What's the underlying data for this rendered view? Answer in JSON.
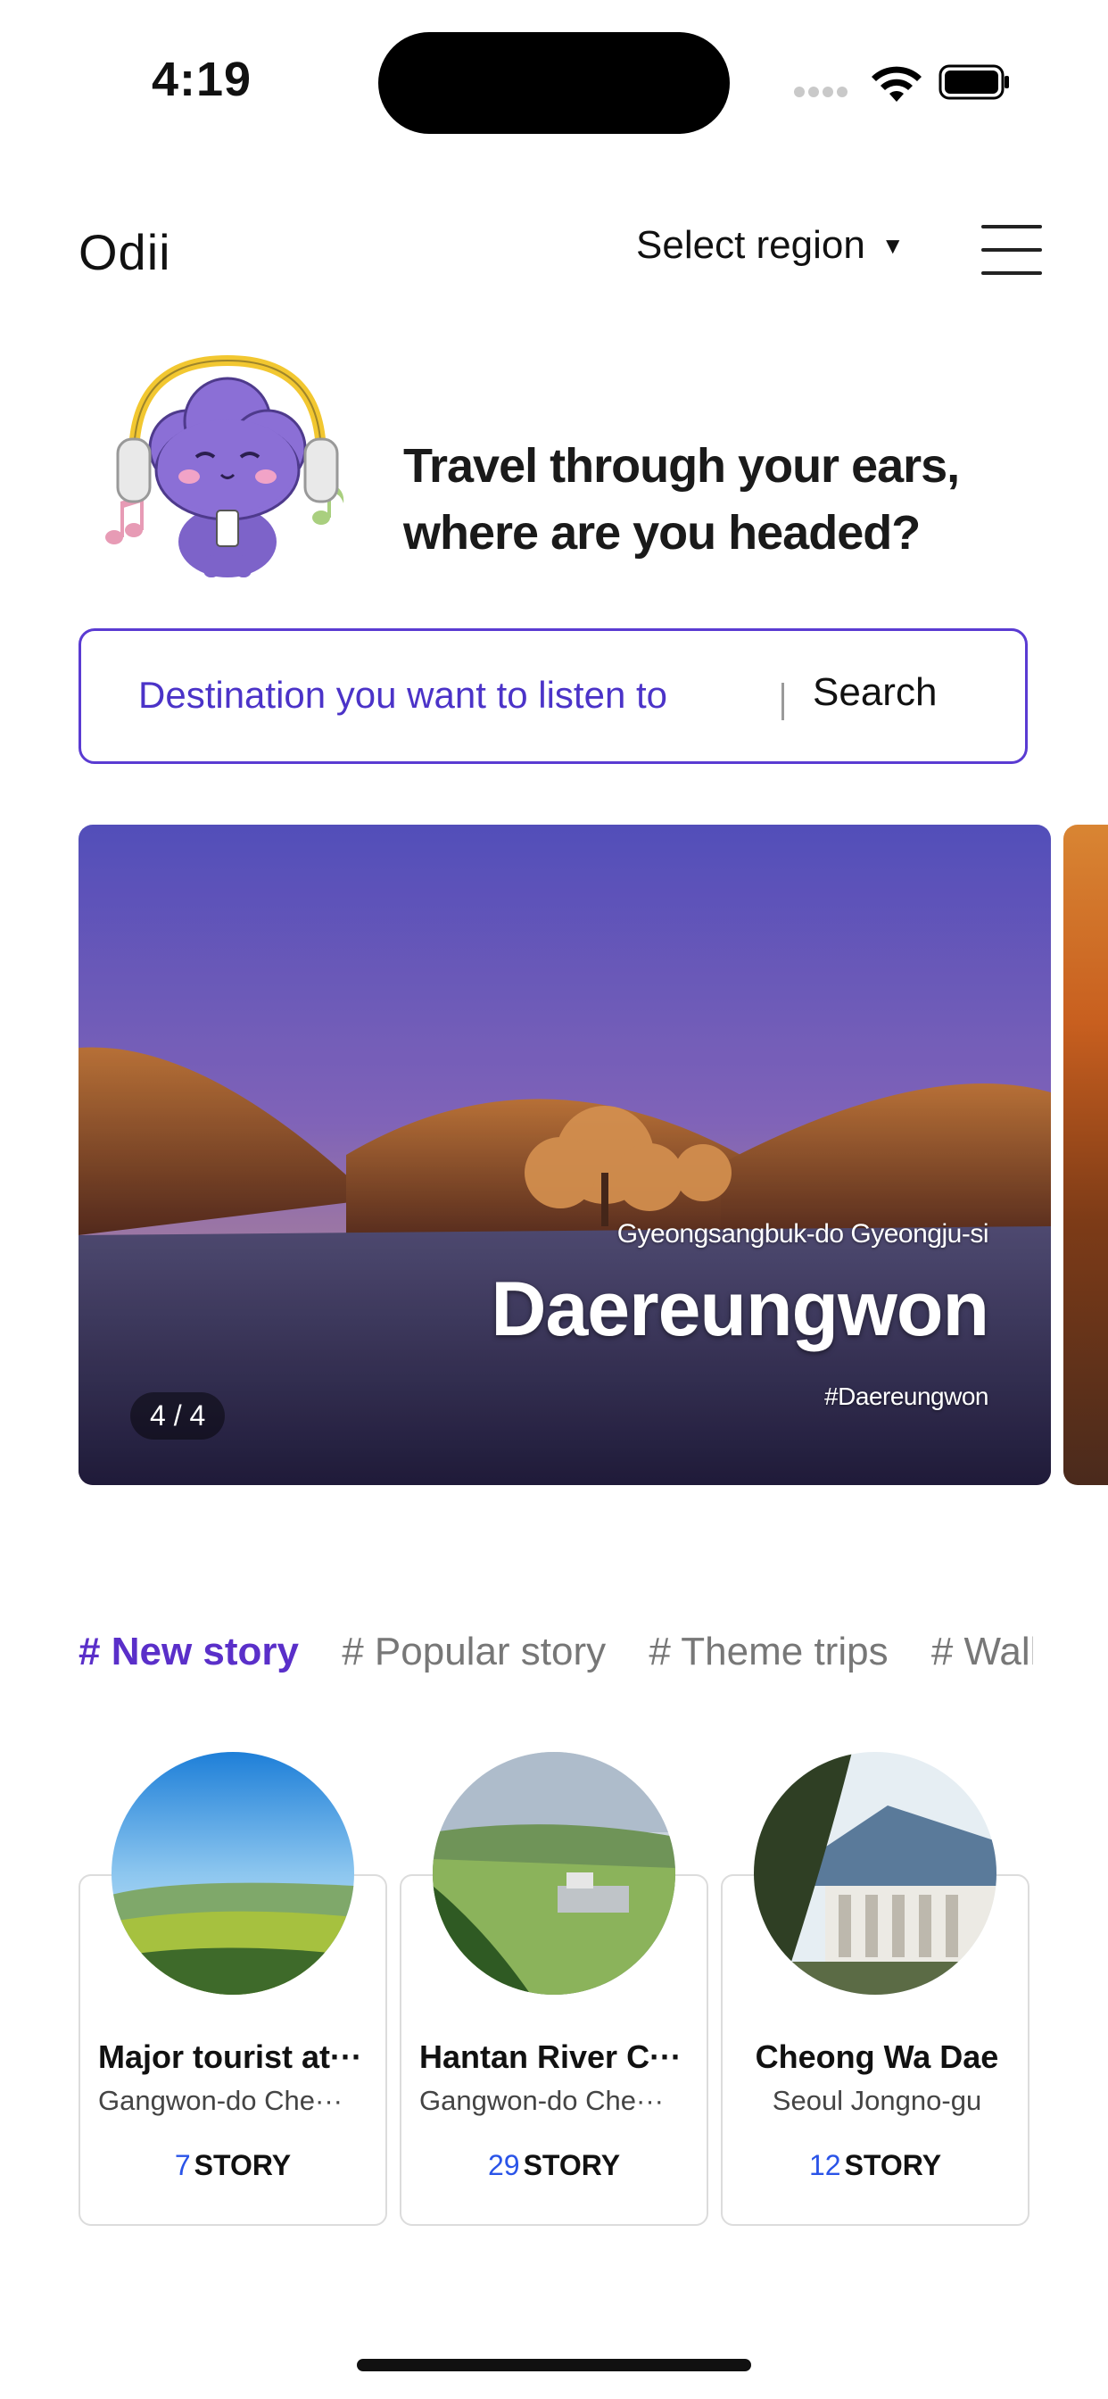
{
  "status_bar": {
    "time": "4:19"
  },
  "header": {
    "logo": "Odii",
    "region_label": "Select region",
    "region_caret": "▼"
  },
  "hero": {
    "headline_line1": "Travel through your ears,",
    "headline_line2": "where are you headed?"
  },
  "search": {
    "placeholder": "Destination you want to listen to",
    "button_label": "Search",
    "accent_color": "#5a3bd2"
  },
  "banner": {
    "region": "Gyeongsangbuk-do Gyeongju-si",
    "title": "Daereungwon",
    "hashtag": "#Daereungwon",
    "counter": "4 / 4"
  },
  "tabs": [
    {
      "label": "# New story",
      "active": true
    },
    {
      "label": "# Popular story",
      "active": false
    },
    {
      "label": "# Theme trips",
      "active": false
    },
    {
      "label": "# Walkin",
      "active": false
    }
  ],
  "cards": [
    {
      "title": "Major tourist at···",
      "subtitle": "Gangwon-do Che···",
      "count": "7",
      "count_suffix": "STORY"
    },
    {
      "title": "Hantan River C···",
      "subtitle": "Gangwon-do Che···",
      "count": "29",
      "count_suffix": "STORY"
    },
    {
      "title": "Cheong Wa Dae",
      "subtitle": "Seoul Jongno-gu",
      "count": "12",
      "count_suffix": "STORY"
    }
  ],
  "colors": {
    "brand_purple": "#5a2fc9",
    "count_blue": "#2a54e8"
  }
}
